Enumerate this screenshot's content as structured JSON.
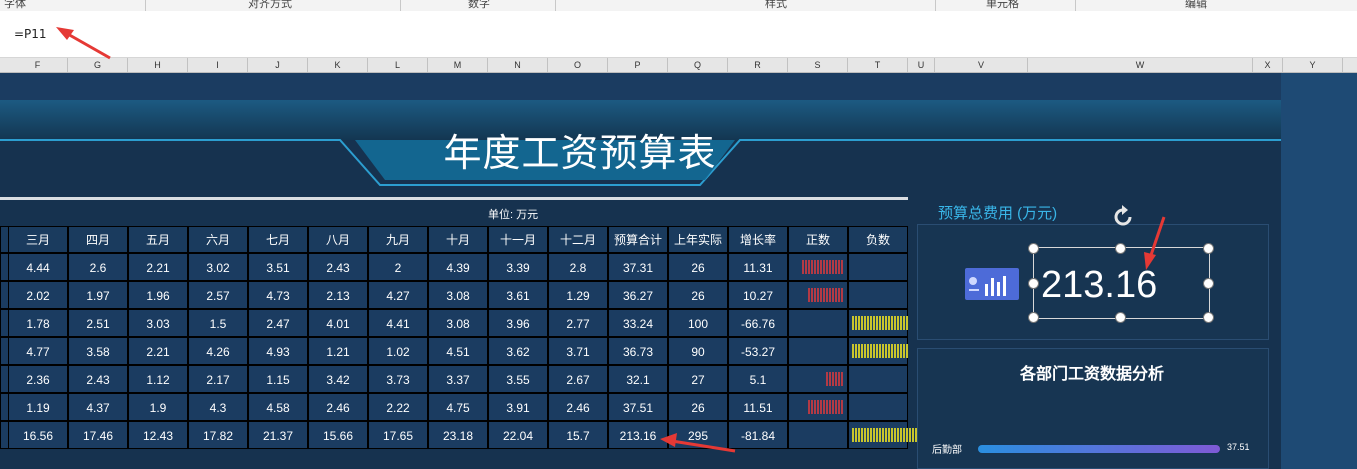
{
  "ribbon": {
    "labels": [
      "字体",
      "对齐方式",
      "数字",
      "样式",
      "单元格",
      "编辑"
    ]
  },
  "formula_bar": {
    "text": "=P11"
  },
  "columns": [
    "F",
    "G",
    "H",
    "I",
    "J",
    "K",
    "L",
    "M",
    "N",
    "O",
    "P",
    "Q",
    "R",
    "S",
    "T",
    "U",
    "V",
    "W",
    "X",
    "Y"
  ],
  "dashboard": {
    "title": "年度工资预算表",
    "unit": "单位: 万元",
    "headers": [
      "三月",
      "四月",
      "五月",
      "六月",
      "七月",
      "八月",
      "九月",
      "十月",
      "十一月",
      "十二月",
      "预算合计",
      "上年实际",
      "增长率",
      "正数",
      "负数"
    ],
    "rows": [
      [
        "4.44",
        "2.6",
        "2.21",
        "3.02",
        "3.51",
        "2.43",
        "2",
        "4.39",
        "3.39",
        "2.8",
        "37.31",
        "26",
        "11.31"
      ],
      [
        "2.02",
        "1.97",
        "1.96",
        "2.57",
        "4.73",
        "2.13",
        "4.27",
        "3.08",
        "3.61",
        "1.29",
        "36.27",
        "26",
        "10.27"
      ],
      [
        "1.78",
        "2.51",
        "3.03",
        "1.5",
        "2.47",
        "4.01",
        "4.41",
        "3.08",
        "3.96",
        "2.77",
        "33.24",
        "100",
        "-66.76"
      ],
      [
        "4.77",
        "3.58",
        "2.21",
        "4.26",
        "4.93",
        "1.21",
        "1.02",
        "4.51",
        "3.62",
        "3.71",
        "36.73",
        "90",
        "-53.27"
      ],
      [
        "2.36",
        "2.43",
        "1.12",
        "2.17",
        "1.15",
        "3.42",
        "3.73",
        "3.37",
        "3.55",
        "2.67",
        "32.1",
        "27",
        "5.1"
      ],
      [
        "1.19",
        "4.37",
        "1.9",
        "4.3",
        "4.58",
        "2.46",
        "2.22",
        "4.75",
        "3.91",
        "2.46",
        "37.51",
        "26",
        "11.51"
      ],
      [
        "16.56",
        "17.46",
        "12.43",
        "17.82",
        "21.37",
        "15.66",
        "17.65",
        "23.18",
        "22.04",
        "15.7",
        "213.16",
        "295",
        "-81.84"
      ]
    ],
    "kpi_title": "预算总费用 (万元)",
    "kpi_value": "213.16",
    "analysis_title": "各部门工资数据分析",
    "dept_bar": {
      "label": "后勤部",
      "value": "37.51"
    }
  },
  "colors": {
    "positive_bar": "#b33a45",
    "negative_bar": "#c9c52c",
    "accent": "#39b6e8",
    "annotation": "#e53935"
  }
}
